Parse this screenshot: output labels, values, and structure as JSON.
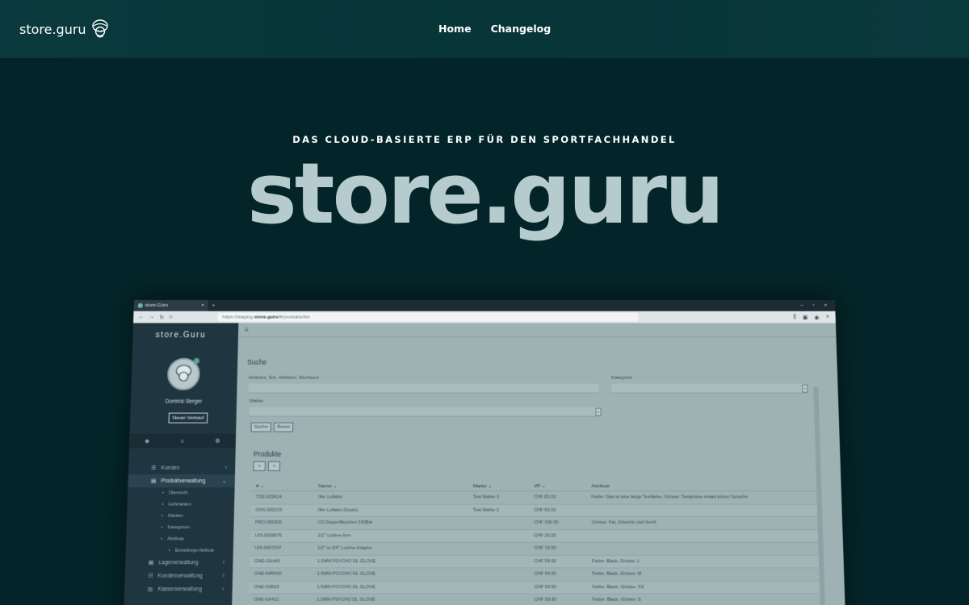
{
  "nav": {
    "brand": "store.guru",
    "links": [
      "Home",
      "Changelog"
    ]
  },
  "hero": {
    "eyebrow": "DAS CLOUD-BASIERTE ERP FÜR DEN SPORTFACHHANDEL",
    "title": "store.guru"
  },
  "colors": {
    "background": "#032428",
    "nav_background": "#0a3a3d",
    "hero_title": "#b6cbcd",
    "sidebar": "#1f3540"
  },
  "mock": {
    "browser": {
      "tab_title": "store.Guru",
      "url_prefix": "https://staging.",
      "url_host": "store.guru",
      "url_path": "/#/produkte/list"
    },
    "sidebar": {
      "logo": "store.Guru",
      "user": "Dominic Berger",
      "new_sale": "Neuer Verkauf",
      "menu": [
        {
          "label": "Kunden",
          "level": 0
        },
        {
          "label": "Produktverwaltung",
          "level": 0,
          "active": true
        },
        {
          "label": "Übersicht",
          "level": 1
        },
        {
          "label": "Lieferanten",
          "level": 1
        },
        {
          "label": "Marken",
          "level": 1
        },
        {
          "label": "Kategorien",
          "level": 1
        },
        {
          "label": "Attribute",
          "level": 1
        },
        {
          "label": "Einstellungs-Attribute",
          "level": 2
        },
        {
          "label": "Lagerverwaltung",
          "level": 0
        },
        {
          "label": "Kundenverwaltung",
          "level": 0
        },
        {
          "label": "Kassenverwaltung",
          "level": 0
        }
      ]
    },
    "search": {
      "title": "Suche",
      "field1_label": "Artikelnr, Ext. Artikelnr, Stichwort",
      "field2_label": "Kategorie",
      "field3_label": "Marke",
      "btn_search": "Suche",
      "btn_reset": "Reset"
    },
    "products": {
      "title": "Produkte",
      "add_icons": [
        "+",
        "+"
      ],
      "columns": [
        "#",
        "Name",
        "Marke",
        "VP",
        "Attribute"
      ],
      "rows": [
        {
          "id": "TDE-929624",
          "name": "Ifler Luftabo",
          "brand": "Test Marke 3",
          "price": "CHF 65.00",
          "attr": "Farbe: Das ist eine lange Testfarbe, Grösse: Testgrösse etwas kürzer Sprache"
        },
        {
          "id": "ONS-000219",
          "name": "Ifler Luftabo (Kopie)",
          "brand": "Test Marke 2",
          "price": "CHF 65.00",
          "attr": ""
        },
        {
          "id": "PRO-000326",
          "name": "CS Doppelflaschen 330Bar",
          "brand": "",
          "price": "CHF 330.00",
          "attr": "Grösse: Fat, Zubehör und Ventil"
        },
        {
          "id": "UIS-0009076",
          "name": "1/2\" Locline Arm",
          "brand": "",
          "price": "CHF 20.00",
          "attr": ""
        },
        {
          "id": "UIS-0007047",
          "name": "1/2\" to 3/4\" Locline Adapter",
          "brand": "",
          "price": "CHF 19.90",
          "attr": ""
        },
        {
          "id": "ONE-GA443",
          "name": "1.5MM PSYCHO DL GLOVE",
          "brand": "",
          "price": "CHF 59.90",
          "attr": "Farbe: Black, Grösse: L"
        },
        {
          "id": "ONE-54R600",
          "name": "1.5MM PSYCHO DL GLOVE",
          "brand": "",
          "price": "CHF 59.90",
          "attr": "Farbe: Black, Grösse: M"
        },
        {
          "id": "ONE-G9603",
          "name": "1.5MM PSYCHO DL GLOVE",
          "brand": "",
          "price": "CHF 59.90",
          "attr": "Farbe: Black, Grösse: XS"
        },
        {
          "id": "ONE-GA411",
          "name": "1.5MM PSYCHO DL GLOVE",
          "brand": "",
          "price": "CHF 59.90",
          "attr": "Farbe: Black, Grösse: S"
        }
      ]
    }
  }
}
